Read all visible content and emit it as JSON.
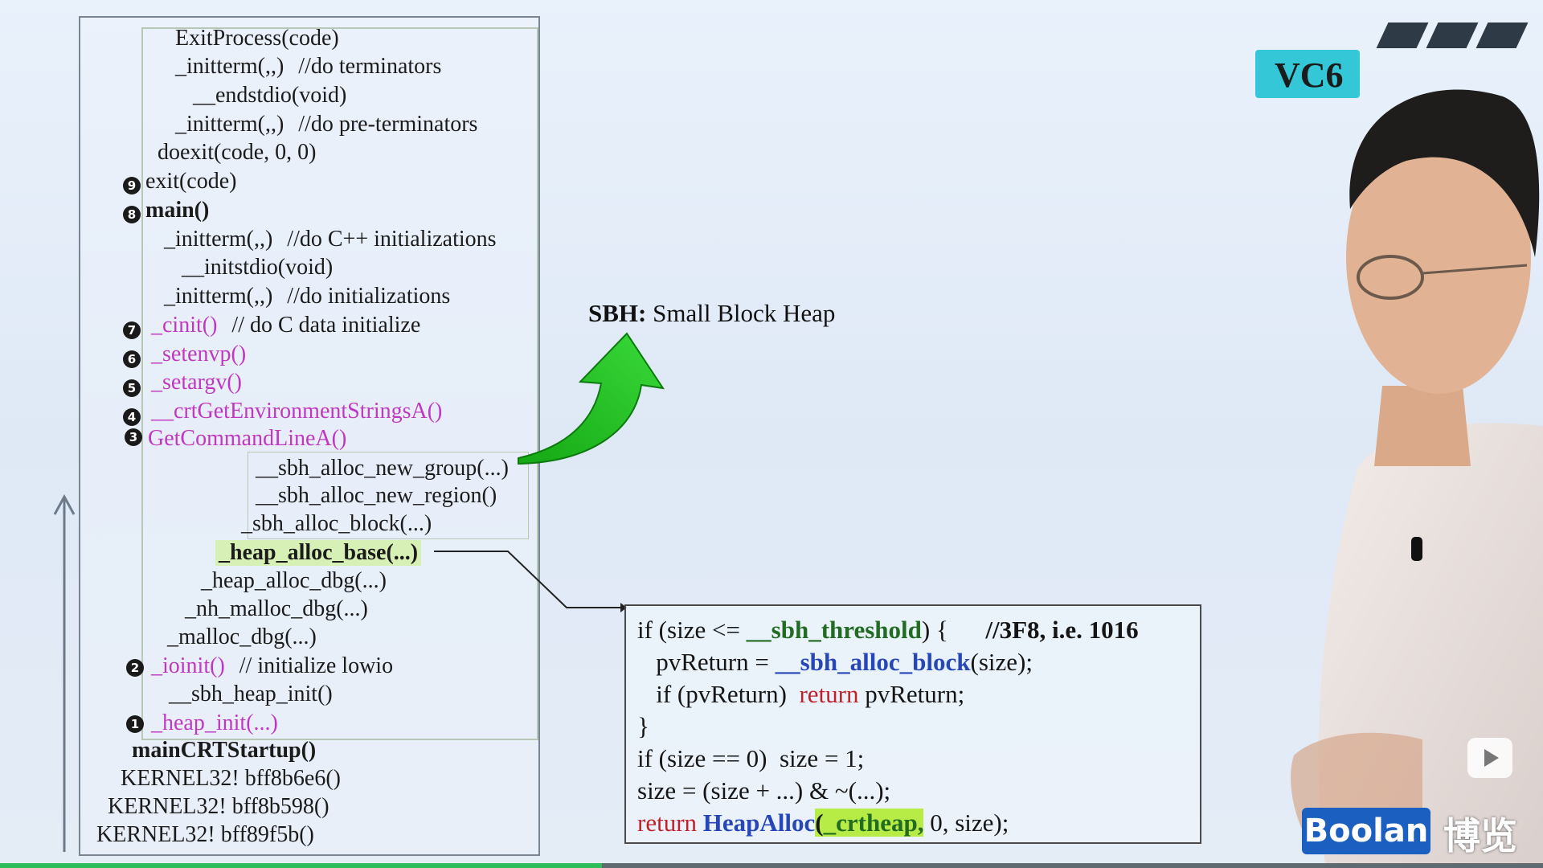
{
  "stack": {
    "lines": [
      {
        "text": "ExitProcess(code)"
      },
      {
        "text": "_initterm(,,)",
        "comment": "//do terminators"
      },
      {
        "text": "__endstdio(void)"
      },
      {
        "text": "_initterm(,,)",
        "comment": "//do pre-terminators"
      },
      {
        "text": "doexit(code, 0, 0)"
      },
      {
        "text": "exit(code)"
      },
      {
        "text": "main()"
      },
      {
        "text": "_initterm(,,)",
        "comment": "//do C++ initializations"
      },
      {
        "text": "__initstdio(void)"
      },
      {
        "text": "_initterm(,,)",
        "comment": "//do initializations"
      },
      {
        "text": "_cinit()",
        "comment": "// do C data initialize"
      },
      {
        "text": "_setenvp()"
      },
      {
        "text": "_setargv()"
      },
      {
        "text": "__crtGetEnvironmentStringsA()"
      },
      {
        "text": "GetCommandLineA()"
      },
      {
        "text": "__sbh_alloc_new_group(...)"
      },
      {
        "text": "__sbh_alloc_new_region()"
      },
      {
        "text": "_sbh_alloc_block(...)"
      },
      {
        "text": "_heap_alloc_base(...)"
      },
      {
        "text": "_heap_alloc_dbg(...)"
      },
      {
        "text": "_nh_malloc_dbg(...)"
      },
      {
        "text": "_malloc_dbg(...)"
      },
      {
        "text": "_ioinit()",
        "comment": "// initialize lowio"
      },
      {
        "text": "__sbh_heap_init()"
      },
      {
        "text": "_heap_init(...)"
      },
      {
        "text": "mainCRTStartup()"
      },
      {
        "text": "KERNEL32! bff8b6e6()"
      },
      {
        "text": "KERNEL32! bff8b598()"
      },
      {
        "text": "KERNEL32! bff89f5b()"
      }
    ],
    "steps": [
      "9",
      "8",
      "7",
      "6",
      "5",
      "4",
      "3",
      "2",
      "1"
    ]
  },
  "title": {
    "acronym": "SBH:",
    "text": "Small Block Heap"
  },
  "code": {
    "line1_pre": "if (size <= ",
    "line1_var": "__sbh_threshold",
    "line1_post": ") {      ",
    "line1_comment": "//3F8, i.e. 1016",
    "line2_pre": "   pvReturn = ",
    "line2_fn": "__sbh_alloc_block",
    "line2_post": "(size);",
    "line3_pre": "   if (pvReturn)  ",
    "line3_kw": "return",
    "line3_post": " pvReturn;",
    "line4": "}",
    "line5": "if (size == 0)  size = 1;",
    "line6": "size = (size + ...) & ~(...);",
    "line7_kw": "return",
    "line7_fn": "HeapAlloc",
    "line7_paren": "(",
    "line7_arg": "_crtheap,",
    "line7_rest": " 0, size);"
  },
  "logo": {
    "vc6": "VC6"
  },
  "brand": {
    "name": "Boolan",
    "cn": "博览"
  },
  "video": {
    "progress": 0.39
  },
  "colors": {
    "magenta": "#c038c2",
    "green_highlight": "#b7ec46",
    "brand_blue": "#1b5fc1",
    "accent_cyan": "#33c7d8"
  }
}
